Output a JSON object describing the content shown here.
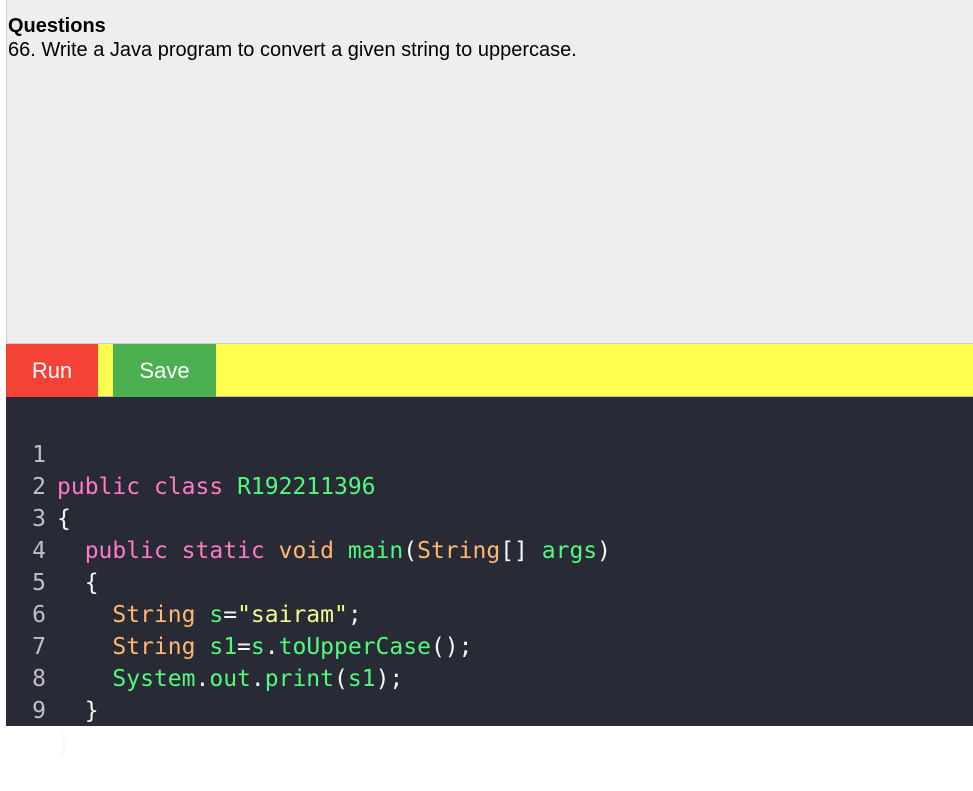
{
  "question": {
    "heading": "Questions",
    "text": "66. Write a Java program to convert a given string to uppercase."
  },
  "toolbar": {
    "run_label": "Run",
    "save_label": "Save"
  },
  "colors": {
    "question_bg": "#eeeeee",
    "toolbar_bg": "#ffff4f",
    "run_button": "#f44336",
    "save_button": "#4caf50",
    "editor_bg": "#282a36",
    "keyword": "#ff79c6",
    "identifier": "#50fa7b",
    "type": "#ffb86c",
    "string": "#f1fa8c"
  },
  "editor": {
    "lines": [
      {
        "num": "1",
        "t": [
          "public",
          " ",
          "class",
          " ",
          "R192211396"
        ]
      },
      {
        "num": "2",
        "t": [
          "{"
        ]
      },
      {
        "num": "3",
        "t": [
          "  ",
          "public",
          " ",
          "static",
          " ",
          "void",
          " ",
          "main",
          "(",
          "String",
          "[]",
          " ",
          "args",
          ")"
        ]
      },
      {
        "num": "4",
        "t": [
          "  ",
          "{"
        ]
      },
      {
        "num": "5",
        "t": [
          "    ",
          "String",
          " ",
          "s",
          "=",
          "\"sairam\"",
          ";"
        ]
      },
      {
        "num": "6",
        "t": [
          "    ",
          "String",
          " ",
          "s1",
          "=",
          "s",
          ".",
          "toUpperCase",
          "()",
          ";"
        ]
      },
      {
        "num": "7",
        "t": [
          "    ",
          "System",
          ".",
          "out",
          ".",
          "print",
          "(",
          "s1",
          ")",
          ";"
        ]
      },
      {
        "num": "8",
        "t": [
          "  ",
          "}"
        ]
      },
      {
        "num": "9",
        "t": [
          "}"
        ]
      }
    ]
  }
}
